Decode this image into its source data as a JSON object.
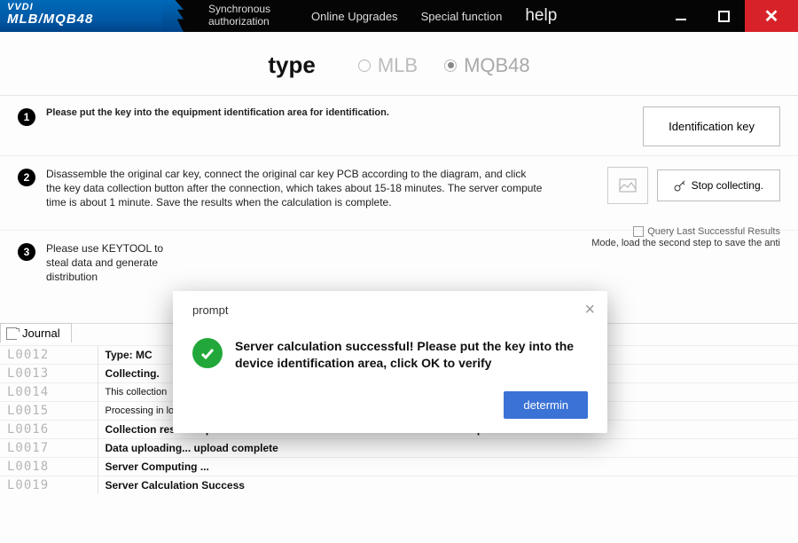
{
  "logo": {
    "brand": "VVDI",
    "product": "MLB/MQB48"
  },
  "menu": {
    "sync": "Synchronous authorization",
    "upgrades": "Online Upgrades",
    "special": "Special function",
    "help": "help"
  },
  "type": {
    "label": "type",
    "opt1": "MLB",
    "opt2": "MQB48"
  },
  "step1": {
    "text": "Please put the key into the equipment identification area for identification.",
    "button": "Identification key"
  },
  "step2": {
    "text": "Disassemble the original car key, connect the original car key PCB according to the diagram, and click the key data collection button after the connection, which takes about 15-18 minutes. The server compute time is about 1 minute. Save the results when the calculation is complete.",
    "button": "Stop collecting.",
    "check_label": "Query Last Successful Results"
  },
  "step3": {
    "text": "Please use KEYTOOL to steal data and generate distribution",
    "extra": "Mode, load the second step to save the anti"
  },
  "journal": {
    "tab": "Journal",
    "rows": [
      {
        "id": "L0012",
        "msg": "Type: MC"
      },
      {
        "id": "L0013",
        "msg": "Collecting."
      },
      {
        "id": "L0014",
        "msg": "This collection"
      },
      {
        "id": "L0015",
        "msg": "Processing in logarithmic paste"
      },
      {
        "id": "L0016",
        "msg": "Collection results zip: c / Users / Luo Haibo / Documents / VVDI-MLB / 1.zip"
      },
      {
        "id": "L0017",
        "msg": "Data uploading... upload complete"
      },
      {
        "id": "L0018",
        "msg": "Server Computing ..."
      },
      {
        "id": "L0019",
        "msg": "Server Calculation Success"
      }
    ]
  },
  "modal": {
    "title": "prompt",
    "message": "Server calculation successful! Please put the key into the device identification area, click OK to verify",
    "ok": "determin"
  }
}
